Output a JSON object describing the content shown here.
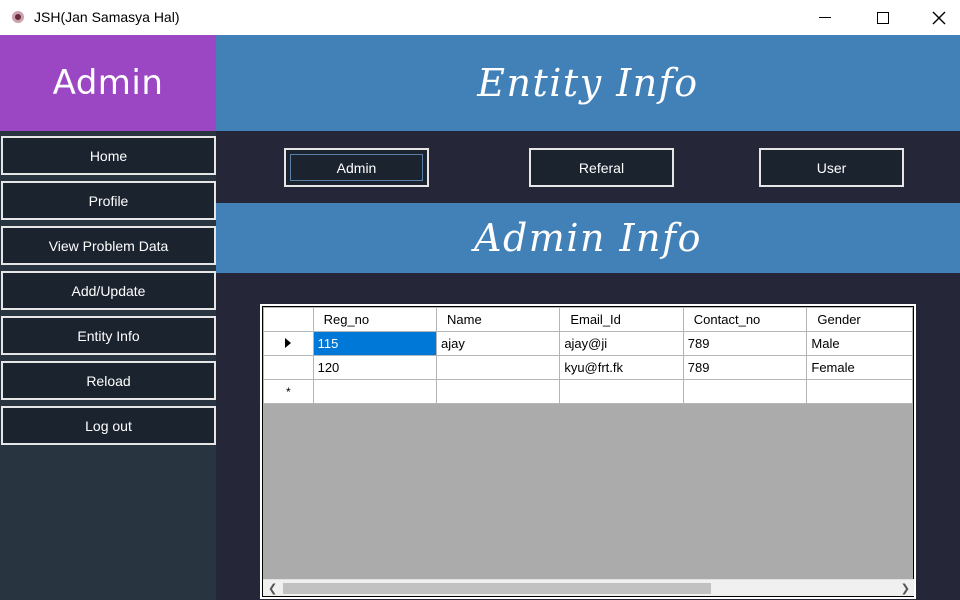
{
  "window": {
    "title": "JSH(Jan Samasya Hal)",
    "app_icon": "app-icon",
    "controls": [
      "minimize-icon",
      "maximize-icon",
      "close-icon"
    ]
  },
  "sidebar": {
    "title": "Admin",
    "items": [
      {
        "label": "Home"
      },
      {
        "label": "Profile"
      },
      {
        "label": "View Problem Data"
      },
      {
        "label": "Add/Update"
      },
      {
        "label": "Entity Info"
      },
      {
        "label": "Reload"
      },
      {
        "label": "Log out"
      }
    ]
  },
  "main": {
    "title": "Entity Info",
    "tabs": [
      {
        "label": "Admin"
      },
      {
        "label": "Referal"
      },
      {
        "label": "User"
      }
    ],
    "section_title": "Admin Info",
    "grid": {
      "columns": [
        "Reg_no",
        "Name",
        "Email_Id",
        "Contact_no",
        "Gender"
      ],
      "rows": [
        [
          "115",
          "ajay",
          "ajay@ji",
          "789",
          "Male"
        ],
        [
          "120",
          "",
          "kyu@frt.fk",
          "789",
          "Female"
        ]
      ],
      "new_row_marker": "*"
    }
  },
  "colors": {
    "sidebar_header": "#9b47c4",
    "sidebar_bg": "#283540",
    "main_bg": "#252638",
    "banner": "#4281b8",
    "button_bg": "#1b232f",
    "selection": "#0078d7"
  }
}
